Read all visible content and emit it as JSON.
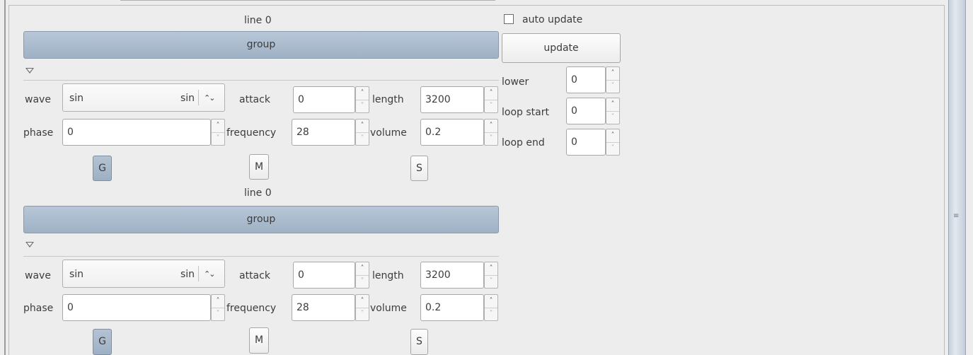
{
  "sidebar": {
    "auto_update_label": "auto update",
    "auto_update_checked": false,
    "update_button": "update",
    "lower": {
      "label": "lower",
      "value": "0"
    },
    "loop_start": {
      "label": "loop start",
      "value": "0"
    },
    "loop_end": {
      "label": "loop end",
      "value": "0"
    }
  },
  "blocks": [
    {
      "line_label": "line 0",
      "group_label": "group",
      "wave": {
        "label": "wave",
        "value": "sin",
        "display": "sin",
        "toggle": "⌃⌄"
      },
      "attack": {
        "label": "attack",
        "value": "0"
      },
      "length": {
        "label": "length",
        "value": "3200"
      },
      "phase": {
        "label": "phase",
        "value": "0"
      },
      "frequency": {
        "label": "frequency",
        "value": "28"
      },
      "volume": {
        "label": "volume",
        "value": "0.2"
      },
      "buttons": {
        "g": "G",
        "m": "M",
        "s": "S"
      }
    },
    {
      "line_label": "line 0",
      "group_label": "group",
      "wave": {
        "label": "wave",
        "value": "sin",
        "display": "sin",
        "toggle": "⌃⌄"
      },
      "attack": {
        "label": "attack",
        "value": "0"
      },
      "length": {
        "label": "length",
        "value": "3200"
      },
      "phase": {
        "label": "phase",
        "value": "0"
      },
      "frequency": {
        "label": "frequency",
        "value": "28"
      },
      "volume": {
        "label": "volume",
        "value": "0.2"
      },
      "buttons": {
        "g": "G",
        "m": "M",
        "s": "S"
      }
    }
  ],
  "icons": {
    "spin_up": "˄",
    "spin_down": "˅",
    "scroll_grip": "≡"
  },
  "colors": {
    "accent": "#a9bacc",
    "background": "#ededed"
  }
}
